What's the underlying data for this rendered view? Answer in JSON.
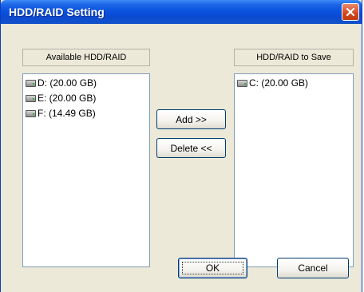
{
  "window": {
    "title": "HDD/RAID Setting"
  },
  "close_icon": "close-icon",
  "left_panel": {
    "header": "Available HDD/RAID",
    "items": [
      {
        "label": "D: (20.00 GB)",
        "icon": "hard-drive-icon"
      },
      {
        "label": "E: (20.00 GB)",
        "icon": "hard-drive-icon"
      },
      {
        "label": "F: (14.49 GB)",
        "icon": "hard-drive-icon"
      }
    ]
  },
  "right_panel": {
    "header": "HDD/RAID to Save",
    "items": [
      {
        "label": "C: (20.00 GB)",
        "icon": "hard-drive-icon"
      }
    ]
  },
  "buttons": {
    "add": "Add >>",
    "delete": "Delete <<",
    "ok": "OK",
    "cancel": "Cancel"
  }
}
